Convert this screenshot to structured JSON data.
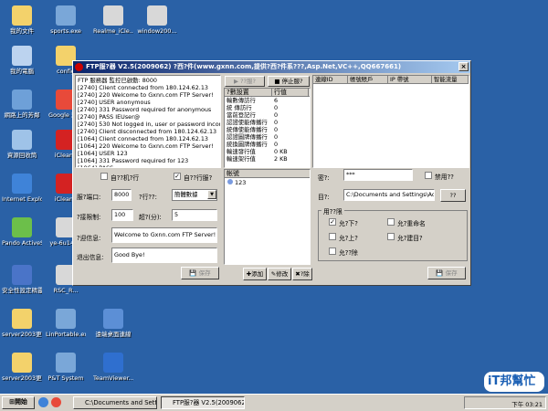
{
  "desktop_icons": [
    {
      "label": "我的文件",
      "icon": "folder-icon",
      "color": "#f3d26b"
    },
    {
      "label": "sports.exe",
      "icon": "exe-icon",
      "color": "#7aa7d8"
    },
    {
      "label": "Realme_iCle...",
      "icon": "file-icon",
      "color": "#d8d8d8"
    },
    {
      "label": "window200...",
      "icon": "file-icon",
      "color": "#d8d8d8"
    },
    {
      "label": "我的電腦",
      "icon": "computer-icon",
      "color": "#bcd3ef"
    },
    {
      "label": "config",
      "icon": "folder-icon",
      "color": "#f3d26b"
    },
    {
      "label": "網路上的芳鄰",
      "icon": "network-icon",
      "color": "#6ea0d8"
    },
    {
      "label": "Google 瀏覽",
      "icon": "chrome-icon",
      "color": "#e84a3a"
    },
    {
      "label": "資源回收筒",
      "icon": "recycle-bin-icon",
      "color": "#9fc3e8"
    },
    {
      "label": "iClean9",
      "icon": "iclean-icon",
      "color": "#d42222"
    },
    {
      "label": "Internet Explorer",
      "icon": "ie-icon",
      "color": "#3f83d8"
    },
    {
      "label": "iClean9",
      "icon": "iclean-icon",
      "color": "#d42222"
    },
    {
      "label": "Pando ActiveSc...",
      "icon": "pando-icon",
      "color": "#6cbf4a"
    },
    {
      "label": "ye-6u14-...",
      "icon": "file-icon",
      "color": "#d8d8d8"
    },
    {
      "label": "安全性設定精靈",
      "icon": "security-icon",
      "color": "#4a74c8"
    },
    {
      "label": "RSC_R...",
      "icon": "file-icon",
      "color": "#d8d8d8"
    },
    {
      "label": "server2003更新",
      "icon": "folder-icon",
      "color": "#f3d26b"
    },
    {
      "label": "LinPortable.exe",
      "icon": "exe-icon",
      "color": "#7aa7d8"
    },
    {
      "label": "遠端桌面連線",
      "icon": "remote-desktop-icon",
      "color": "#5c8fd6"
    },
    {
      "label": "server2003更新",
      "icon": "folder-icon",
      "color": "#f3d26b"
    },
    {
      "label": "P&T System",
      "icon": "exe-icon",
      "color": "#7aa7d8"
    },
    {
      "label": "TeamViewer...",
      "icon": "teamviewer-icon",
      "color": "#2f6fcf"
    }
  ],
  "window": {
    "title": "FTP服?器 V2.5(2009062)  ?西?件(www.gxnn.com,提供?西?件系???,Asp.Net,VC++,QQ667661)",
    "close": "×",
    "log_lines": [
      "FTP 服務器 監控已啟動: 8000",
      "[2740] Client connected from 180.124.62.13",
      "[2740] 220 Welcome to Gxnn.com FTP Server!",
      "[2740] USER anonymous",
      "[2740] 331 Password required for anonymous",
      "[2740] PASS IEUser@",
      "[2740] 530 Not logged in, user or password incorrect!",
      "[2740] Client disconnected from 180.124.62.13",
      "[1064] Client connected from 180.124.62.13",
      "[1064] 220 Welcome to Gxnn.com FTP Server!",
      "[1064] USER 123",
      "[1064] 331 Password required for 123",
      "[1064] PASS"
    ],
    "start_button": "??服?",
    "stop_button": "停止服?",
    "stats_header": [
      "?數設置",
      "行值"
    ],
    "stats": [
      [
        "輸數傳訪行",
        "6"
      ],
      [
        "統  傳訪行",
        "0"
      ],
      [
        "當前登記行",
        "0"
      ],
      [
        "認證使能傳播行",
        "0"
      ],
      [
        "統傳使能傳播行",
        "0"
      ],
      [
        "認證圖牌傳播行",
        "0"
      ],
      [
        "統換圖牌傳播行",
        "0"
      ],
      [
        "輸速發行值",
        "0 KB"
      ],
      [
        "輸速架行值",
        "2 KB"
      ]
    ],
    "client_header": [
      "連線ID",
      "帳號賬戶",
      "IP 帶號",
      "智能流量"
    ],
    "auto_start_label": "自??机?行",
    "auto_run_label": "自??行服?",
    "port_label": "服?端口:",
    "port_value": "8000",
    "lang_label": "?行??:",
    "lang_value": "簡體數據",
    "max_conn_label": "?接限制:",
    "max_conn_value": "100",
    "timeout_label": "超?(分):",
    "timeout_value": "5",
    "welcome_label": "?迎信息:",
    "welcome_value": "Welcome to Gxnn.com FTP Server!",
    "goodbye_label": "退出信息:",
    "goodbye_value": "Good Bye!",
    "save_button": "保存",
    "users_header": "帐號",
    "users": [
      "123"
    ],
    "add_button": "添加",
    "edit_button": "修改",
    "delete_button": "?除",
    "password_label": "密?:",
    "password_value": "***",
    "disabled_label": "禁用??",
    "dir_label": "目?:",
    "dir_value": "C:\\Documents and Settings\\Admin",
    "browse_button": "??",
    "perm_title": "用??限",
    "perms": [
      "允?下?",
      "允?重命名",
      "允?上?",
      "允?建目?",
      "允??除"
    ],
    "save_button2": "保存"
  },
  "taskbar": {
    "start": "開始",
    "tasks": [
      "C:\\Documents and Setting...",
      "FTP服?器 V2.5(2009062..."
    ],
    "clock": "下午 03:21"
  },
  "watermark": "iT邦幫忙"
}
